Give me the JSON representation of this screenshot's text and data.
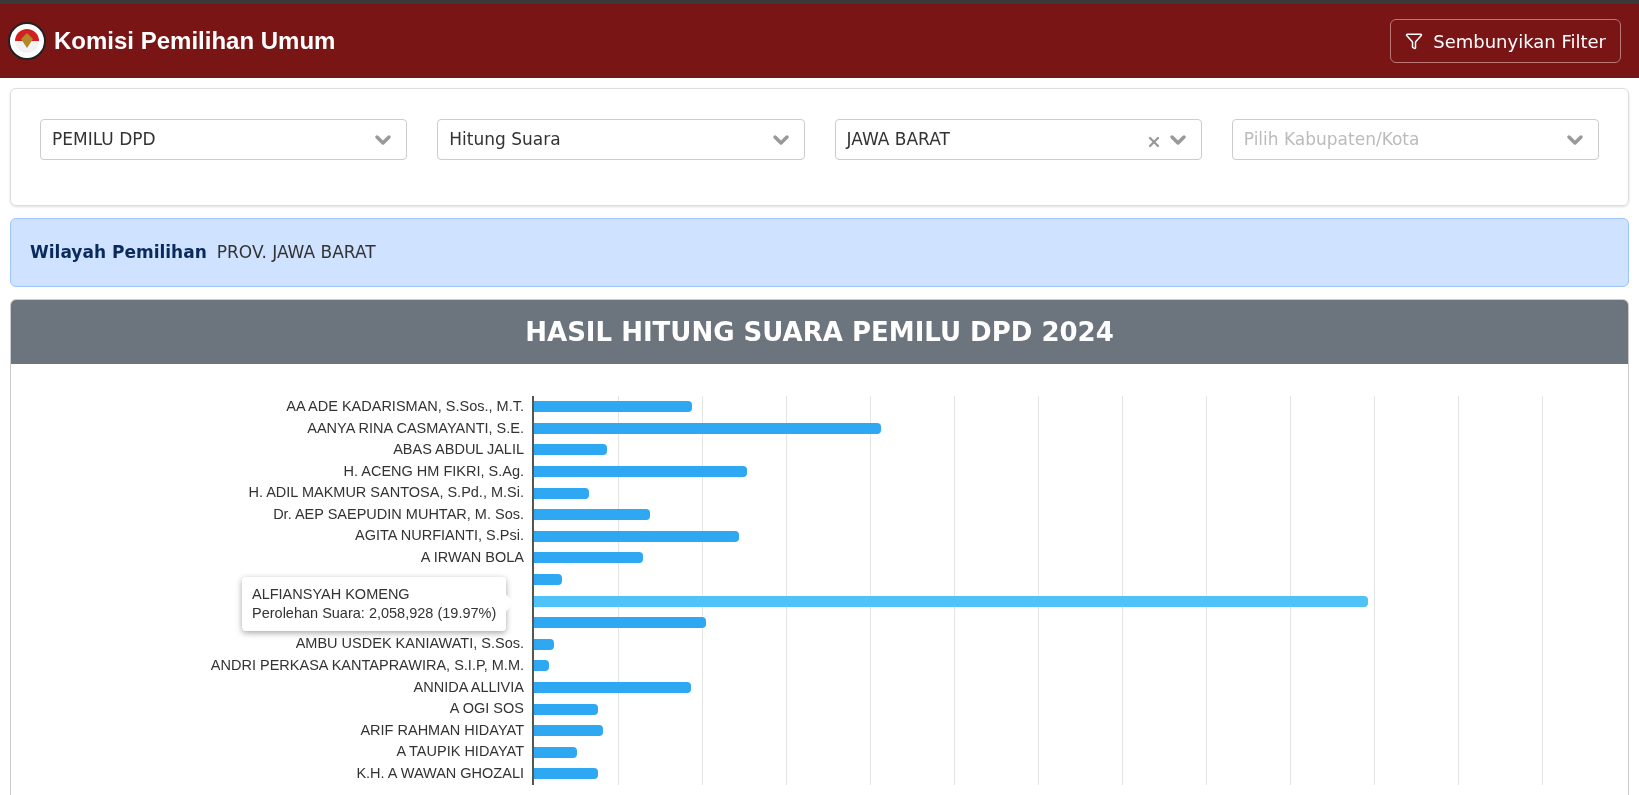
{
  "header": {
    "title": "Komisi Pemilihan Umum",
    "filter_button": "Sembunyikan Filter"
  },
  "filters": [
    {
      "value": "PEMILU DPD",
      "clearable": false
    },
    {
      "value": "Hitung Suara",
      "clearable": false
    },
    {
      "value": "JAWA BARAT",
      "clearable": true
    },
    {
      "placeholder": "Pilih Kabupaten/Kota",
      "clearable": false
    }
  ],
  "region": {
    "label": "Wilayah Pemilihan",
    "value": "PROV. JAWA BARAT"
  },
  "chart": {
    "title": "HASIL HITUNG SUARA PEMILU DPD 2024",
    "rows": [
      {
        "name": "AA ADE KADARISMAN, S.Sos., M.T.",
        "highlighted": false
      },
      {
        "name": "AANYA RINA CASMAYANTI, S.E.",
        "highlighted": false
      },
      {
        "name": "ABAS ABDUL JALIL",
        "highlighted": false
      },
      {
        "name": "H. ACENG HM FIKRI, S.Ag.",
        "highlighted": false
      },
      {
        "name": "H. ADIL MAKMUR SANTOSA, S.Pd., M.Si.",
        "highlighted": false
      },
      {
        "name": "Dr. AEP SAEPUDIN MUHTAR, M. Sos.",
        "highlighted": false
      },
      {
        "name": "AGITA NURFIANTI, S.Psi.",
        "highlighted": false
      },
      {
        "name": "A IRWAN BOLA",
        "highlighted": false
      },
      {
        "highlighted": false
      },
      {
        "highlighted": true
      },
      {
        "highlighted": false
      },
      {
        "name": "AMBU USDEK KANIAWATI, S.Sos.",
        "highlighted": false
      },
      {
        "name": "ANDRI PERKASA KANTAPRAWIRA, S.I.P, M.M.",
        "highlighted": false
      },
      {
        "name": "ANNIDA ALLIVIA",
        "highlighted": false
      },
      {
        "name": "A OGI SOS",
        "highlighted": false
      },
      {
        "name": "ARIF RAHMAN HIDAYAT",
        "highlighted": false
      },
      {
        "name": "A TAUPIK HIDAYAT",
        "highlighted": false
      },
      {
        "name": "K.H. A WAWAN GHOZALI",
        "highlighted": false
      }
    ],
    "tooltip": {
      "title": "ALFIANSYAH KOMENG",
      "body": "Perolehan Suara: 2,058,928 (19.97%)"
    }
  }
}
